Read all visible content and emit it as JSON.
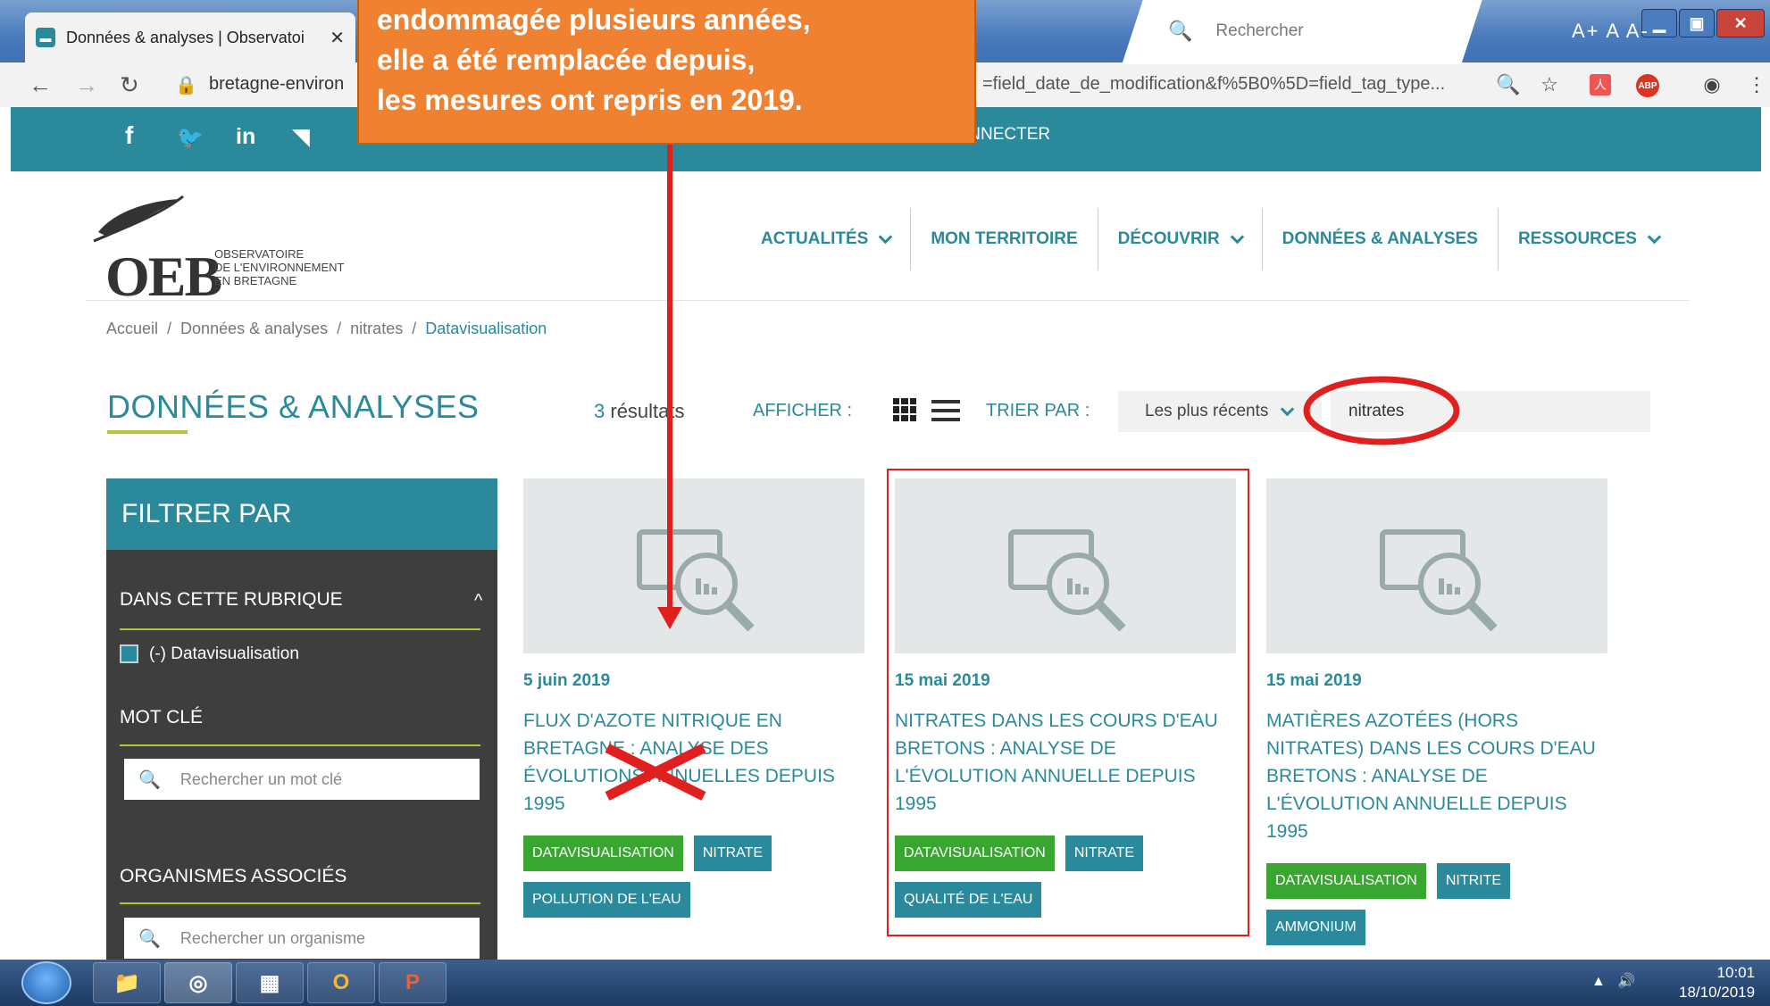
{
  "browser": {
    "tab_title": "Données & analyses | Observatoi",
    "url_domain": "bretagne-environ",
    "url_params": "=field_date_de_modification&f%5B0%5D=field_tag_type...",
    "abp_label": "ABP"
  },
  "site": {
    "social": [
      "f",
      "t",
      "in",
      "rss"
    ],
    "connect_label": "ME CONNECTER",
    "search_placeholder": "Rechercher",
    "font_controls": "A+ A  A-",
    "logo_text": "OEB",
    "logo_subtitle_lines": [
      "OBSERVATOIRE",
      "DE L'ENVIRONNEMENT",
      "EN BRETAGNE"
    ],
    "nav": [
      {
        "label": "ACTUALITÉS",
        "dropdown": true
      },
      {
        "label": "MON TERRITOIRE",
        "dropdown": false
      },
      {
        "label": "DÉCOUVRIR",
        "dropdown": true
      },
      {
        "label": "DONNÉES & ANALYSES",
        "dropdown": false
      },
      {
        "label": "RESSOURCES",
        "dropdown": true
      }
    ],
    "breadcrumb": [
      "Accueil",
      "Données & analyses",
      "nitrates",
      "Datavisualisation"
    ]
  },
  "listing": {
    "title": "DONNÉES & ANALYSES",
    "results_count": "3",
    "results_label": "résultats",
    "afficher_label": "AFFICHER :",
    "trier_label": "TRIER PAR :",
    "sort_value": "Les plus récents",
    "keyword_value": "nitrates"
  },
  "sidebar": {
    "heading": "FILTRER PAR",
    "section_rubrique": "DANS CETTE RUBRIQUE",
    "rubrique_item": "(-)  Datavisualisation",
    "section_motcle": "MOT CLÉ",
    "motcle_placeholder": "Rechercher un mot clé",
    "section_organismes": "ORGANISMES ASSOCIÉS",
    "organisme_placeholder": "Rechercher un organisme"
  },
  "cards": [
    {
      "date": "5 juin 2019",
      "title": "FLUX D'AZOTE NITRIQUE EN BRETAGNE : ANALYSE DES ÉVOLUTIONS ANNUELLES DEPUIS 1995",
      "tags": [
        {
          "label": "DATAVISUALISATION",
          "color": "green"
        },
        {
          "label": "NITRATE",
          "color": "teal"
        },
        {
          "label": "POLLUTION DE L'EAU",
          "color": "teal"
        }
      ]
    },
    {
      "date": "15 mai 2019",
      "title": "NITRATES DANS LES COURS D'EAU BRETONS : ANALYSE DE L'ÉVOLUTION ANNUELLE DEPUIS 1995",
      "tags": [
        {
          "label": "DATAVISUALISATION",
          "color": "green"
        },
        {
          "label": "NITRATE",
          "color": "teal"
        },
        {
          "label": "QUALITÉ DE L'EAU",
          "color": "teal"
        }
      ]
    },
    {
      "date": "15 mai 2019",
      "title": "MATIÈRES AZOTÉES (HORS NITRATES) DANS LES COURS D'EAU BRETONS : ANALYSE DE L'ÉVOLUTION ANNUELLE DEPUIS 1995",
      "tags": [
        {
          "label": "DATAVISUALISATION",
          "color": "green"
        },
        {
          "label": "NITRITE",
          "color": "teal"
        },
        {
          "label": "AMMONIUM",
          "color": "teal"
        }
      ]
    }
  ],
  "annotation": {
    "callout_lines": [
      "endommagée plusieurs années,",
      "elle a été remplacée depuis,",
      "les mesures ont repris en 2019."
    ],
    "callout_color": "#f08131",
    "mark_color": "#e01f1f"
  },
  "taskbar": {
    "apps": [
      "explorer",
      "chrome",
      "calculator",
      "outlook",
      "powerpoint"
    ],
    "time": "10:01",
    "date": "18/10/2019"
  },
  "colors": {
    "teal": "#2a8a9b",
    "green": "#3aa632",
    "accent_line": "#b5c43a",
    "sidebar_bg": "#3e3e3e"
  }
}
